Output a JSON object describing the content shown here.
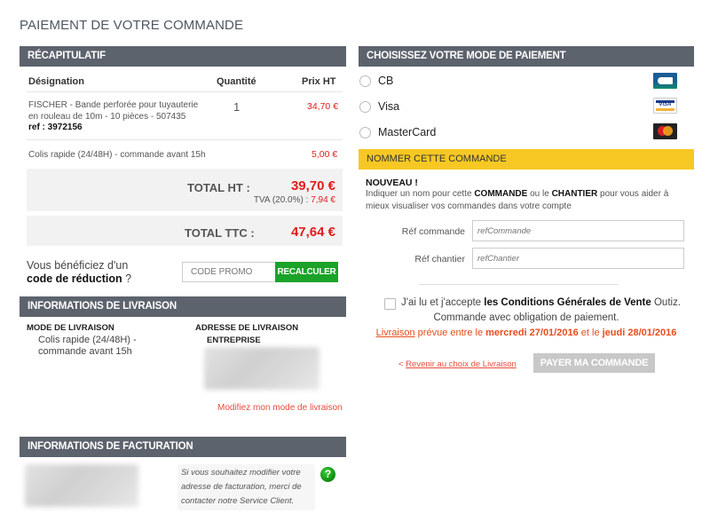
{
  "page": {
    "title": "PAIEMENT DE VOTRE COMMANDE"
  },
  "recap": {
    "header": "RÉCAPITULATIF",
    "columns": {
      "designation": "Désignation",
      "quantity": "Quantité",
      "price": "Prix HT"
    },
    "items": [
      {
        "line1": "FISCHER - Bande perforée pour tuyauterie",
        "line2": "en rouleau de 10m - 10 pièces - 507435",
        "ref": "ref : 3972156",
        "quantity": "1",
        "price": "34,70 €"
      }
    ],
    "shipping": {
      "label": "Colis rapide (24/48H) - commande avant 15h",
      "price": "5,00 €"
    },
    "total_ht": {
      "label": "TOTAL HT :",
      "value": "39,70 €",
      "tva_label": "TVA (20.0%) :",
      "tva_value": "7,94 €"
    },
    "total_ttc": {
      "label": "TOTAL TTC :",
      "value": "47,64 €"
    }
  },
  "promo": {
    "text_line1": "Vous bénéficiez d'un",
    "text_bold": "code de réduction",
    "text_suffix": " ?",
    "placeholder": "CODE PROMO",
    "button": "RECALCULER",
    "button_color": "#1aa328"
  },
  "delivery": {
    "header": "INFORMATIONS DE LIVRAISON",
    "mode_title": "MODE DE LIVRAISON",
    "mode_line1": "Colis rapide (24/48H) -",
    "mode_line2": "commande avant 15h",
    "address_title": "ADRESSE DE LIVRAISON",
    "address_company": "ENTREPRISE",
    "modify_link": "Modifiez mon mode de livraison"
  },
  "billing": {
    "header": "INFORMATIONS DE FACTURATION",
    "info_line1": "Si vous souhaitez modifier votre",
    "info_line2": "adresse de facturation, merci de",
    "info_line3": "contacter notre Service Client.",
    "help_icon": "?"
  },
  "payment": {
    "header": "CHOISISSEZ VOTRE MODE DE PAIEMENT",
    "options": [
      {
        "label": "CB",
        "icon": "cb-card-icon"
      },
      {
        "label": "Visa",
        "icon": "visa-card-icon"
      },
      {
        "label": "MasterCard",
        "icon": "mastercard-card-icon"
      }
    ],
    "visa_text": "VISA"
  },
  "name_order": {
    "header": "NOMMER CETTE COMMANDE",
    "header_color": "#f7c824",
    "new_label": "NOUVEAU !",
    "hint_a": "Indiquer un nom pour cette ",
    "hint_b": "COMMANDE",
    "hint_c": " ou le ",
    "hint_d": "CHANTIER",
    "hint_e": " pour vous aider à",
    "hint_line2": "mieux visualiser vos commandes dans votre compte",
    "fields": [
      {
        "label": "Réf commande",
        "placeholder": "refCommande",
        "value": ""
      },
      {
        "label": "Réf chantier",
        "placeholder": "refChantier",
        "value": ""
      }
    ]
  },
  "terms": {
    "accept_a": "J'ai lu et j'accepte ",
    "accept_bold": "les Conditions Générales de Vente",
    "accept_c": " Outiz.",
    "obligation": "Commande avec obligation de paiement.",
    "delivery_link": "Livraison",
    "delivery_a": " prévue entre le ",
    "delivery_date1": "mercredi 27/01/2016",
    "delivery_b": " et le ",
    "delivery_date2": "jeudi 28/01/2016",
    "checked": false
  },
  "actions": {
    "back_prefix": "< ",
    "back_link": "Revenir au choix de Livraison",
    "pay_button": "PAYER MA COMMANDE",
    "pay_disabled": true
  }
}
